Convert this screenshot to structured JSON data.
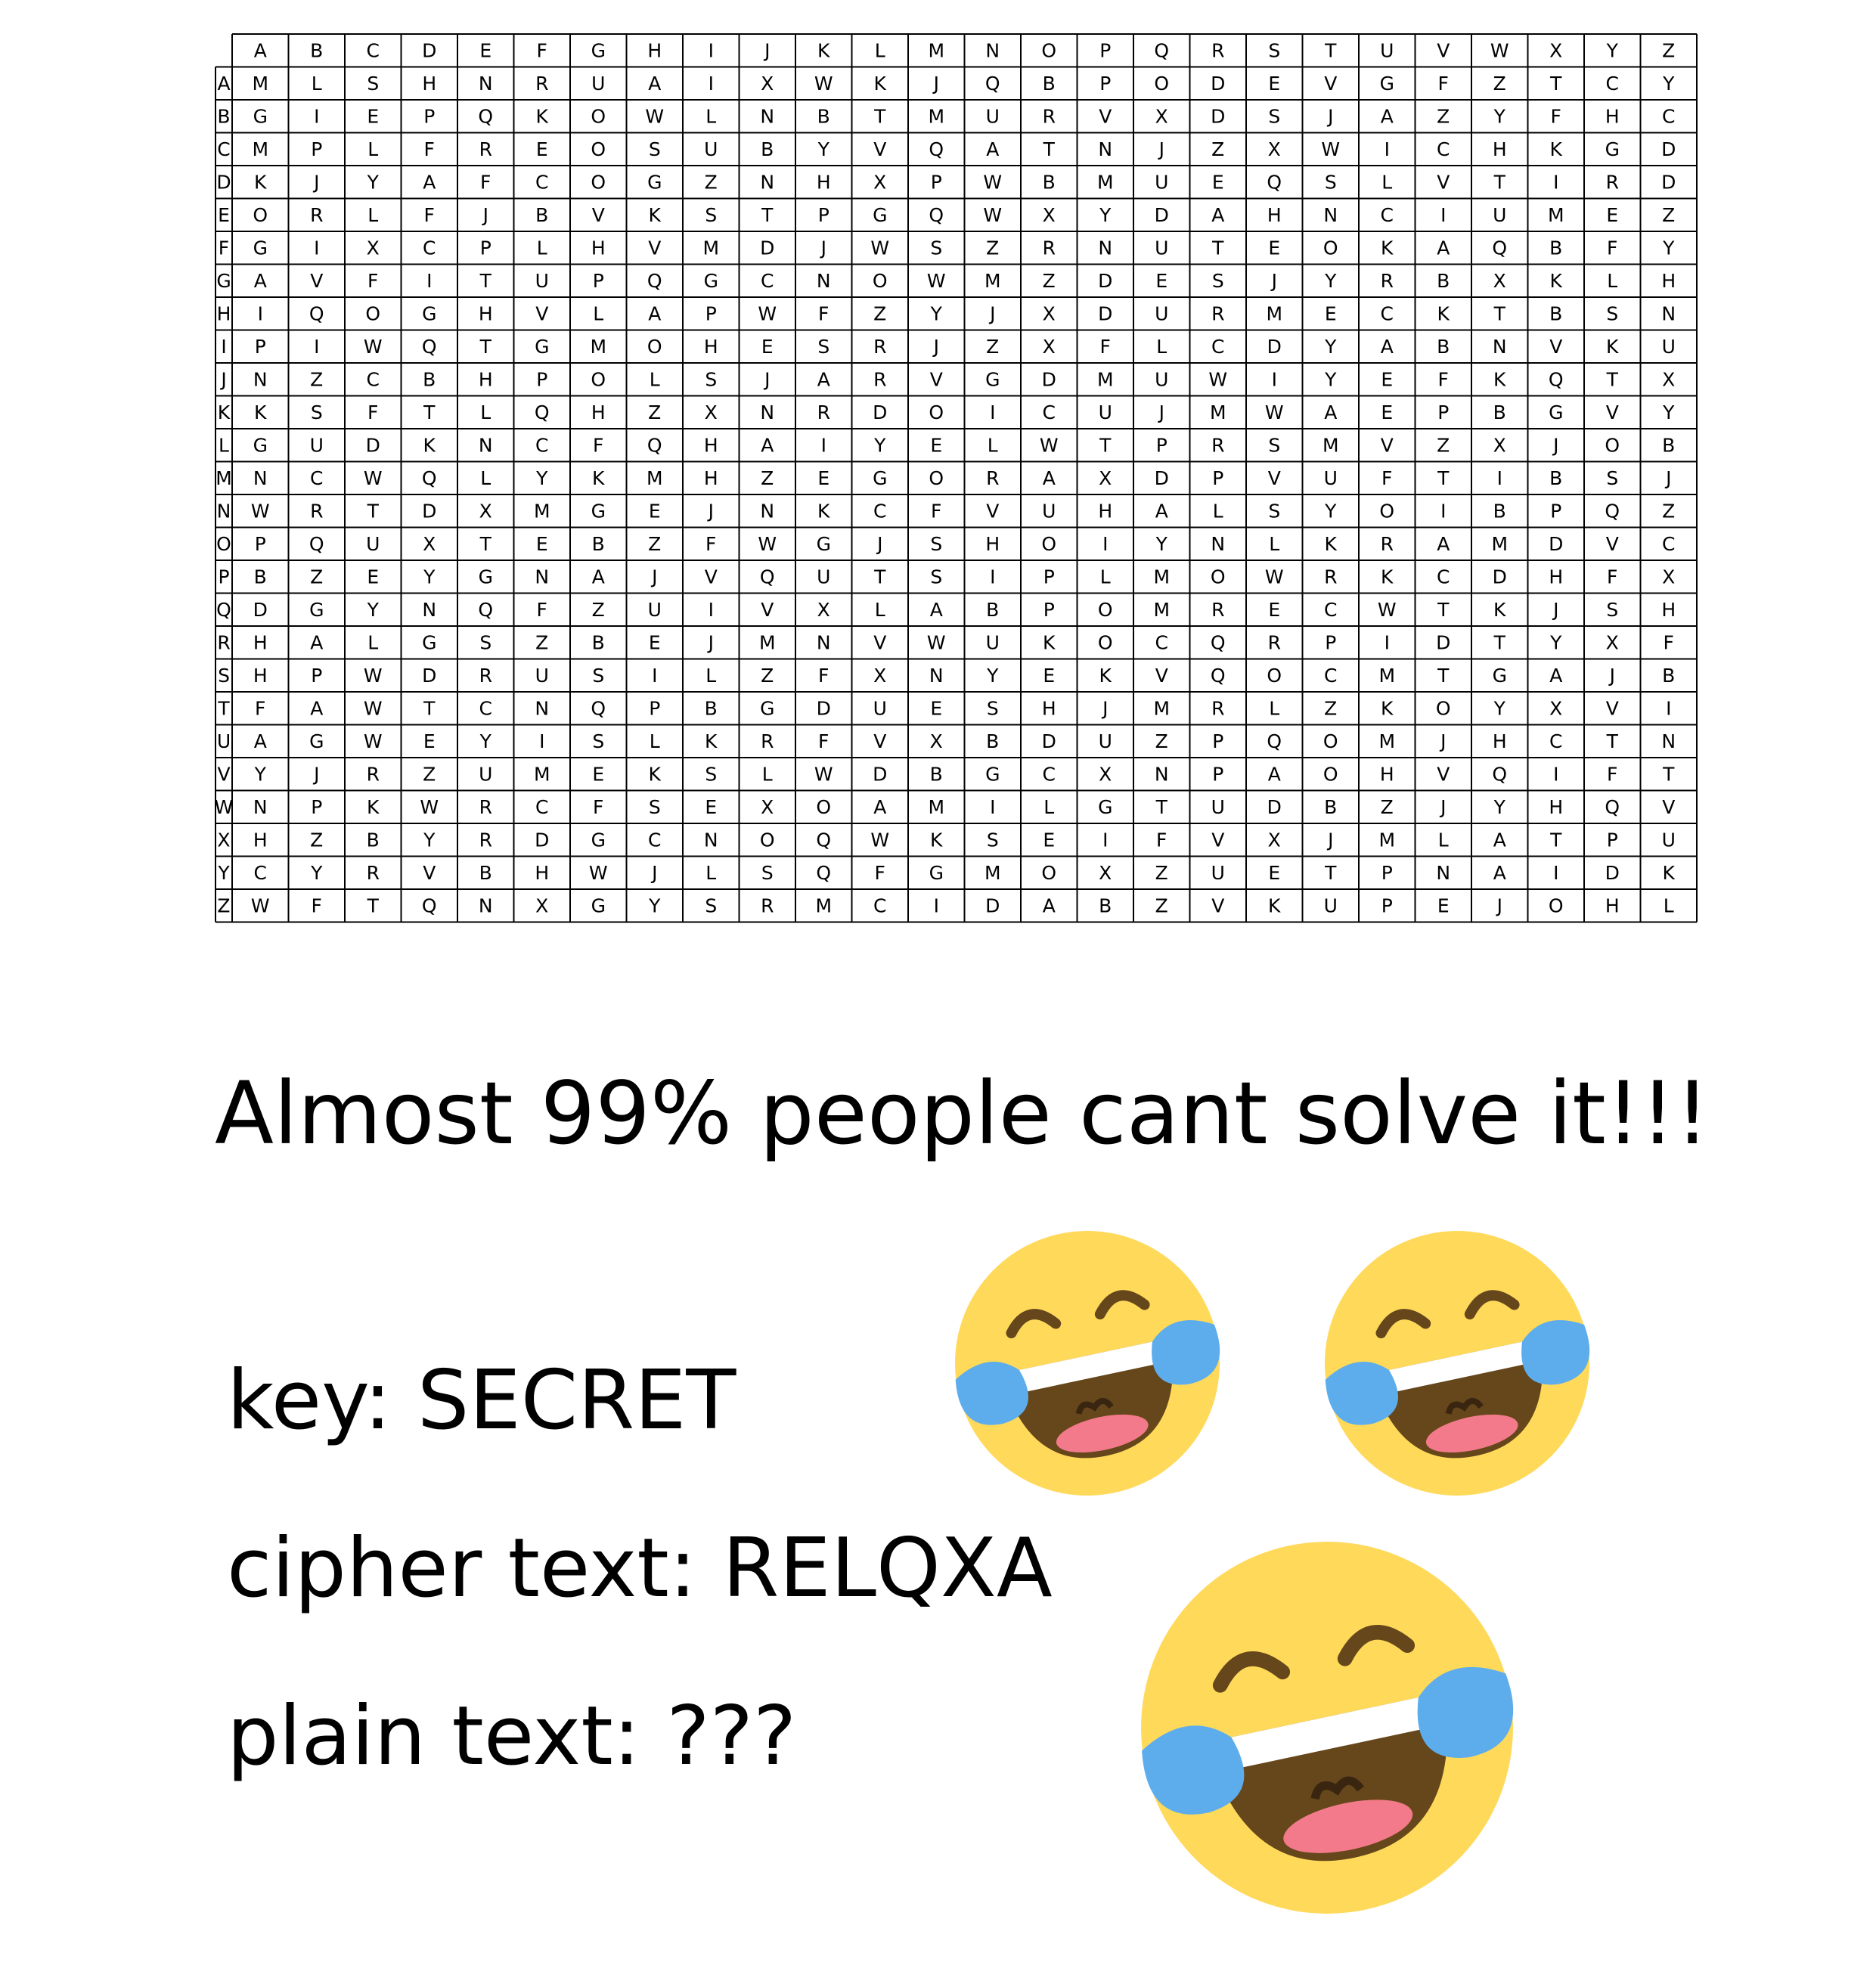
{
  "grid": {
    "col_headers": [
      "A",
      "B",
      "C",
      "D",
      "E",
      "F",
      "G",
      "H",
      "I",
      "J",
      "K",
      "L",
      "M",
      "N",
      "O",
      "P",
      "Q",
      "R",
      "S",
      "T",
      "U",
      "V",
      "W",
      "X",
      "Y",
      "Z"
    ],
    "row_headers": [
      "A",
      "B",
      "C",
      "D",
      "E",
      "F",
      "G",
      "H",
      "I",
      "J",
      "K",
      "L",
      "M",
      "N",
      "O",
      "P",
      "Q",
      "R",
      "S",
      "T",
      "U",
      "V",
      "W",
      "X",
      "Y",
      "Z"
    ],
    "rows": [
      "MLSHNRUAIXWKJQBPODEVGFZTCY",
      "GIEPQKOWLNBTMURVXDSJAZYFHC",
      "MPLFREOSUBYVQATNJZXWICHKGD",
      "KJYAFCOGZNHXPWBMUEQSLVTIRD",
      "ORLFJBVKSTPGQWXYDAHNCIUMEZ",
      "GIXCPLHVMDJWSZRNUTEOKAQBFY",
      "AVFITUPQGCNOWMZDESJYRBXKLH",
      "IQOGHVLAPWFZYJXDURMECKTBSN",
      "PIWQTGMOHESRJZXFLCDYABNVKU",
      "NZCBHPOLSJARVGDMUWIYEFKQTX",
      "KSFTLQHZXNRDOICUJMWAEPBGVY",
      "GUDKNCFQHAIYELWTPRSMVZXJOB",
      "NCWQLYKMHZEGORAXDPVUFTIBSJ",
      "WRTDXMGEJNKCFVUHALSYOIBPQZ",
      "PQUXTEBZFWGJSHOIYNLKRAMDVC",
      "BZEYGNAJVQUTSIPLMOWRKCDHFX",
      "DGYNQFZUIVXLABPOMRECWTKJSH",
      "HALGSZBEJMNVWUKOCQRPIDTYXF",
      "HPWDRUSILZFXNYEKVQOCMTGAJB",
      "FAWTCNQPBGDUESHJMRLZKOYXVI",
      "AGWEYISLKRFVXBDUZPQOMJHCTN",
      "YJRZUMEKSLWDBGCXNPAOHVQIFT",
      "NPKWRCFSEXOAMILGTUDBZJYHQV",
      "HZBYRDGCNOQWKSEIFVXJMLATPU",
      "CYRVBHWJLSQFGMOXZUETPNAIDK",
      "WFTQNXGYSRMCIDABZVKUPEJOHL"
    ]
  },
  "headline": "Almost 99% people cant solve it!!!",
  "puzzle": {
    "key_line": "key: SECRET",
    "cipher_line": "cipher text: RELQXA",
    "plain_line": "plain text: ???"
  },
  "emoji_name": "face-with-tears-of-joy",
  "colors": {
    "face": "#FFD95A",
    "tear": "#5DADEC",
    "mouth": "#65471B",
    "tongue": "#F37A8A",
    "teeth": "#FFFFFF"
  }
}
